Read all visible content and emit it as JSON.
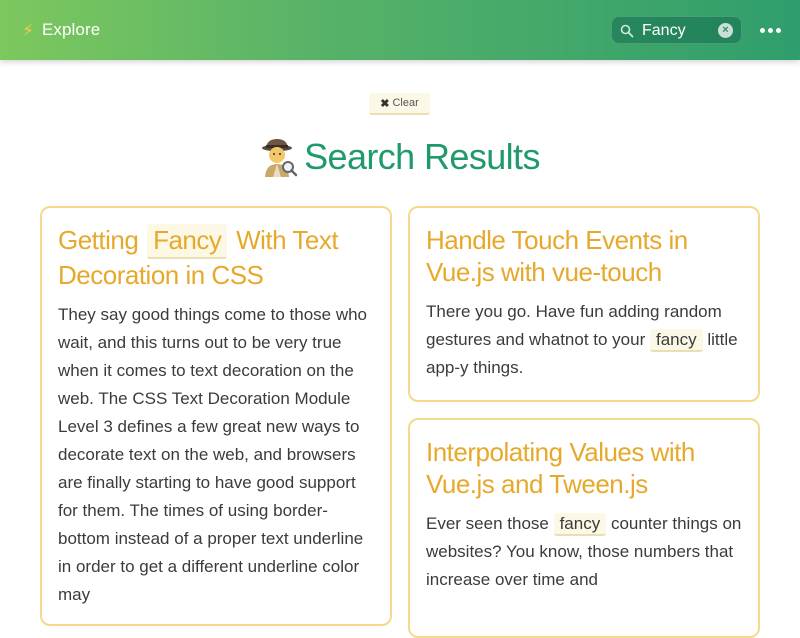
{
  "app": {
    "title": "Explore",
    "brand_icon": "lightning-bolt-icon"
  },
  "search": {
    "value": "Fancy",
    "placeholder": "Search",
    "icon": "search-icon",
    "clear_icon": "clear-search-icon"
  },
  "menu": {
    "icon": "more-dots-icon"
  },
  "clear_button": {
    "icon": "x",
    "label": "Clear"
  },
  "heading": {
    "icon": "detective-icon",
    "text": "Search Results"
  },
  "colors": {
    "header_start": "#7dc85e",
    "header_end": "#2f9e6c",
    "heading": "#1f9a6b",
    "card_title": "#e6a92c",
    "card_border": "#f5d98c",
    "highlight_bg": "#fcf8e6"
  },
  "results": [
    {
      "title_before": "Getting ",
      "title_match": "Fancy",
      "title_after": " With Text Decoration in CSS",
      "body": "They say good things come to those who wait, and this turns out to be very true when it comes to text decoration on the web. The CSS Text Decoration Module Level 3 defines a few great new ways to decorate text on the web, and browsers are finally starting to have good support for them. The times of using border-bottom instead of a proper text underline in order to get a different underline color may"
    },
    {
      "title": "Handle Touch Events in Vue.js with vue-touch",
      "body_before": "There you go. Have fun adding random gestures and whatnot to your ",
      "body_match": "fancy",
      "body_after": " little app-y things."
    },
    {
      "title": "Interpolating Values with Vue.js and Tween.js",
      "body_before": "Ever seen those ",
      "body_match": "fancy",
      "body_after": " counter things on websites? You know, those numbers that increase over time and"
    }
  ]
}
